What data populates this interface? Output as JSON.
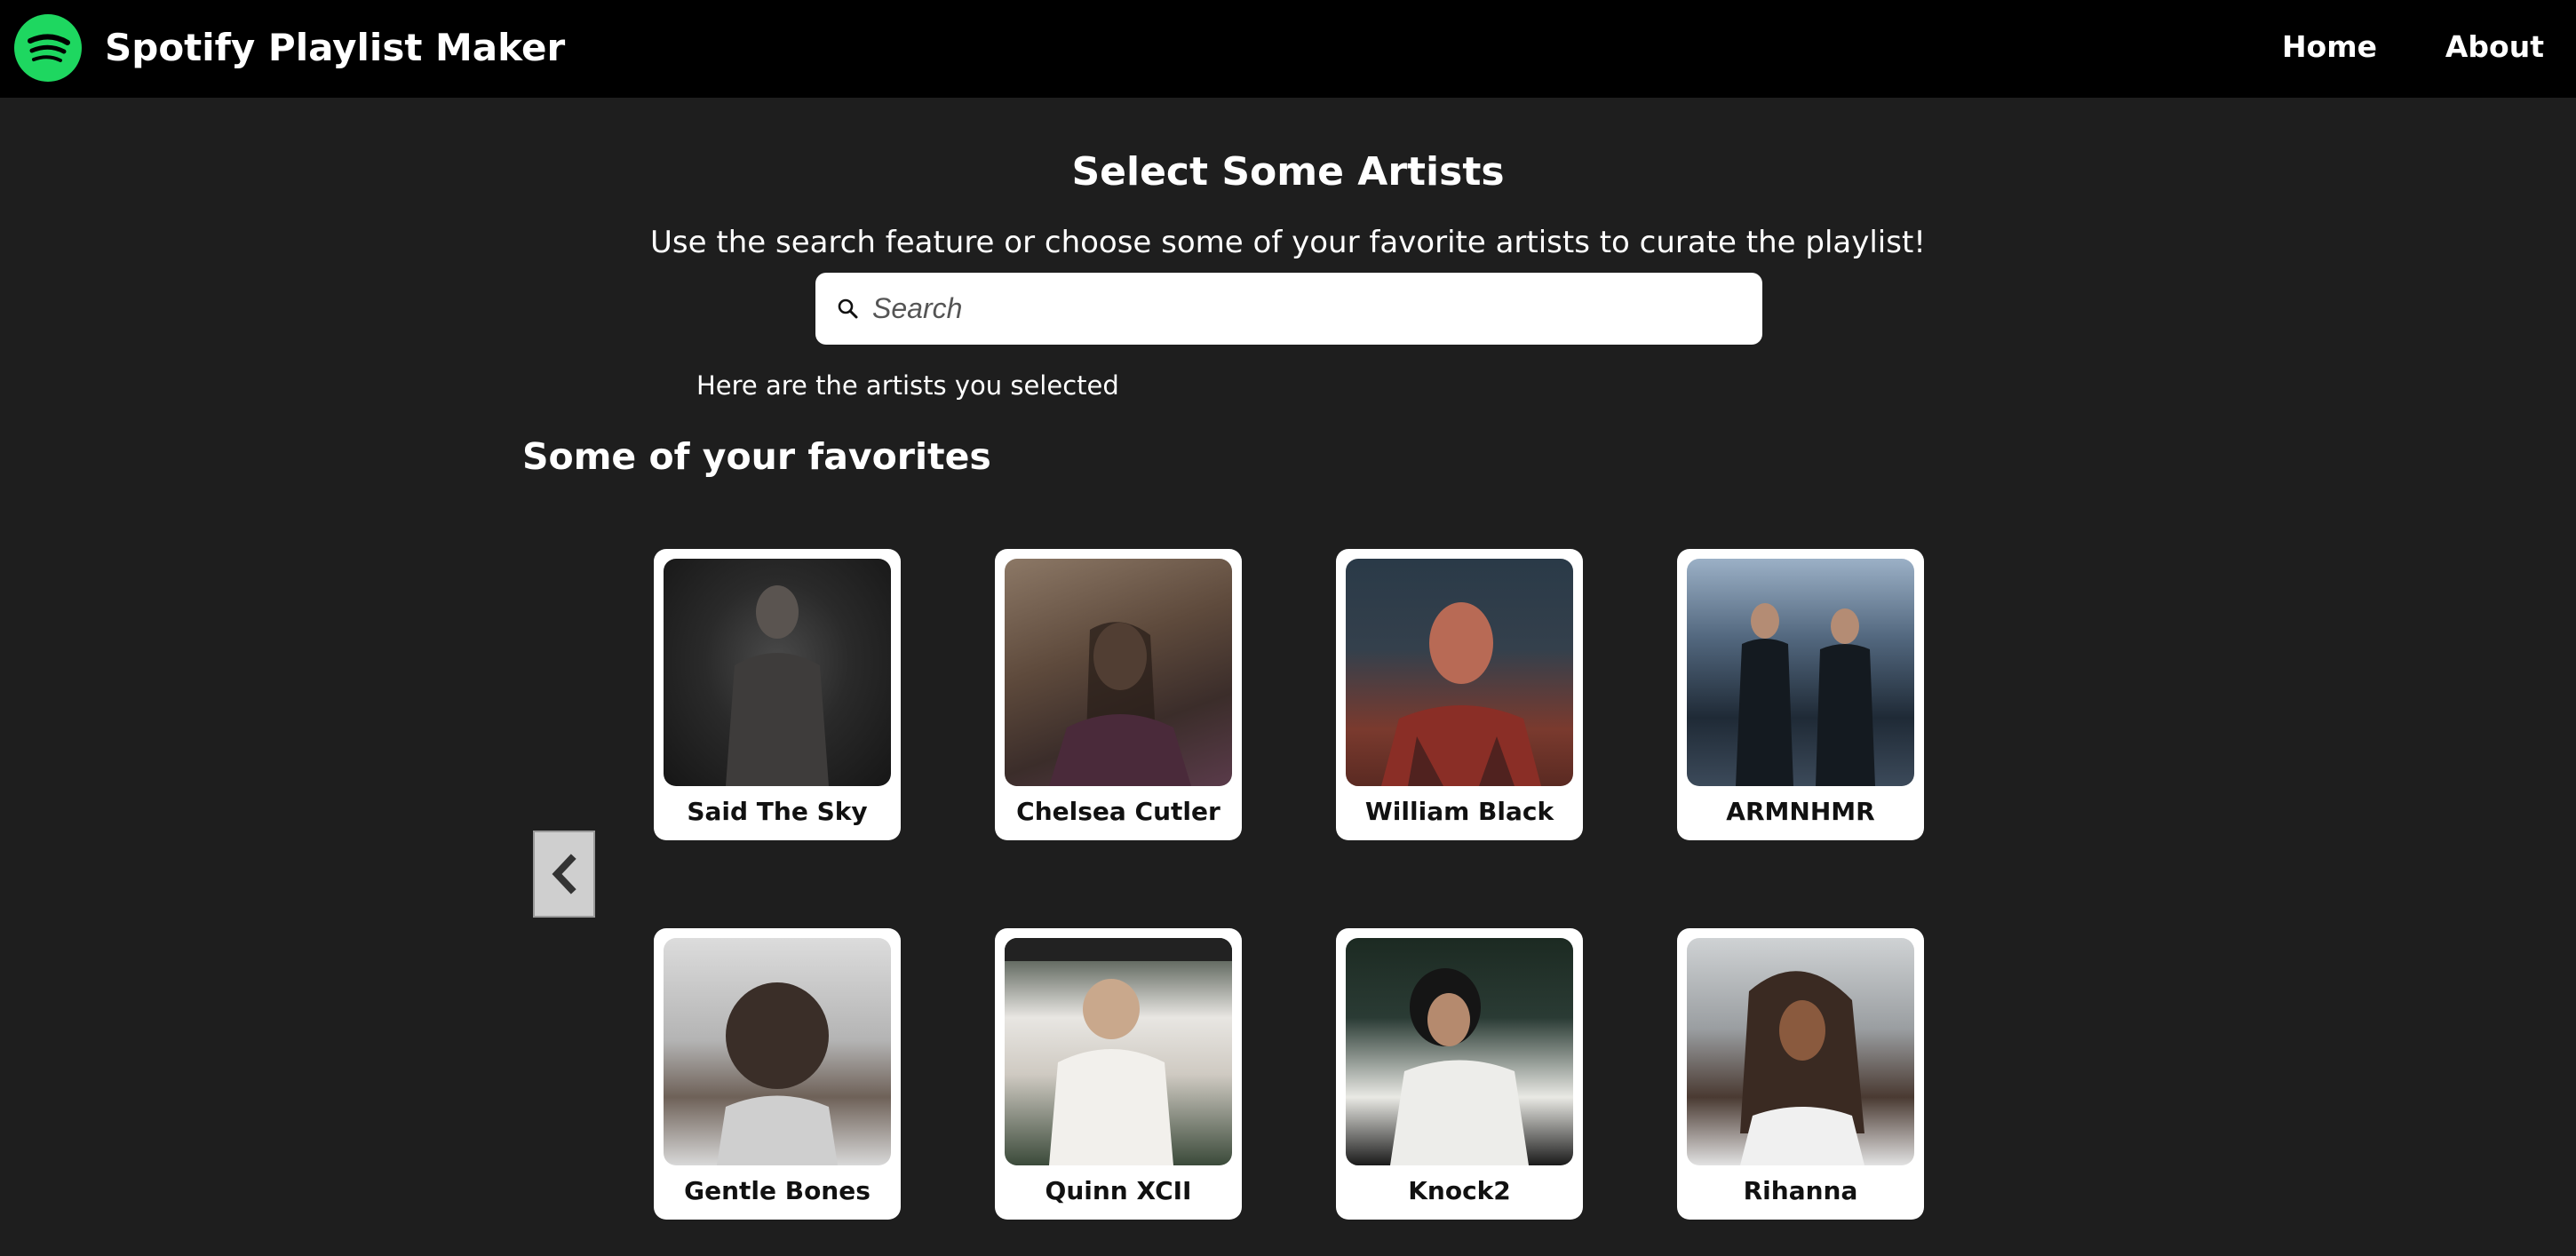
{
  "header": {
    "brand": "Spotify Playlist Maker",
    "logo_icon": "spotify-logo-icon",
    "nav": [
      {
        "label": "Home"
      },
      {
        "label": "About"
      }
    ]
  },
  "main": {
    "title": "Select Some Artists",
    "subtitle": "Use the search feature or choose some of your favorite artists to curate the playlist!",
    "search": {
      "placeholder": "Search",
      "value": "",
      "icon": "search-icon"
    },
    "selected_label": "Here are the artists you selected",
    "favorites_title": "Some of your favorites",
    "prev_icon": "chevron-left-icon"
  },
  "artists": [
    {
      "name": "Said The Sky"
    },
    {
      "name": "Chelsea Cutler"
    },
    {
      "name": "William Black"
    },
    {
      "name": "ARMNHMR"
    },
    {
      "name": "Gentle Bones"
    },
    {
      "name": "Quinn XCII"
    },
    {
      "name": "Knock2"
    },
    {
      "name": "Rihanna"
    }
  ],
  "colors": {
    "background": "#1e1e1e",
    "header": "#000000",
    "accent": "#1ed760",
    "card": "#ffffff"
  }
}
